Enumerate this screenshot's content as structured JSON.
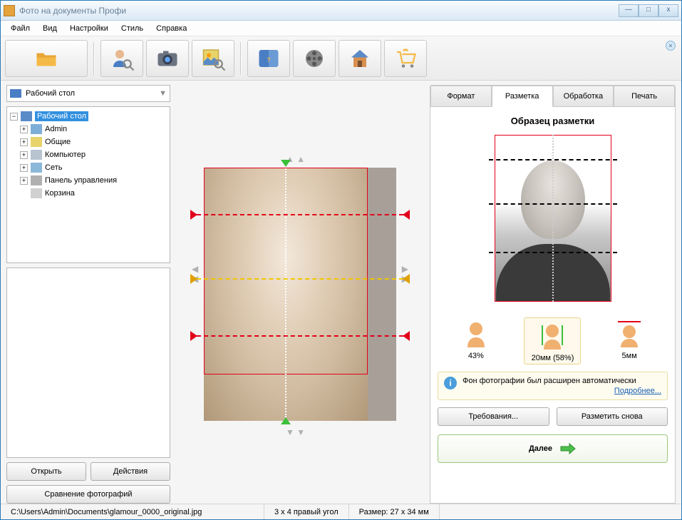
{
  "title": "Фото на документы Профи",
  "menu": {
    "file": "Файл",
    "view": "Вид",
    "settings": "Настройки",
    "style": "Стиль",
    "help": "Справка"
  },
  "winbtns": {
    "min": "—",
    "max": "□",
    "close": "x"
  },
  "dropdown": {
    "label": "Рабочий стол",
    "arrow": "▼"
  },
  "tree": [
    {
      "label": "Рабочий стол",
      "icon": "ic-monitor",
      "expandable": true,
      "expanded": true,
      "selected": true,
      "indent": 0
    },
    {
      "label": "Admin",
      "icon": "ic-folder-blue",
      "expandable": true,
      "expanded": false,
      "indent": 1
    },
    {
      "label": "Общие",
      "icon": "ic-folder",
      "expandable": true,
      "expanded": false,
      "indent": 1
    },
    {
      "label": "Компьютер",
      "icon": "ic-computer",
      "expandable": true,
      "expanded": false,
      "indent": 1
    },
    {
      "label": "Сеть",
      "icon": "ic-network",
      "expandable": true,
      "expanded": false,
      "indent": 1
    },
    {
      "label": "Панель управления",
      "icon": "ic-cpanel",
      "expandable": true,
      "expanded": false,
      "indent": 1
    },
    {
      "label": "Корзина",
      "icon": "ic-trash",
      "expandable": false,
      "indent": 1
    }
  ],
  "leftbtns": {
    "open": "Открыть",
    "actions": "Действия",
    "compare": "Сравнение фотографий"
  },
  "tabs": {
    "format": "Формат",
    "markup": "Разметка",
    "processing": "Обработка",
    "print": "Печать"
  },
  "sample_title": "Образец разметки",
  "measures": {
    "m1": "43%",
    "m2": "20мм (58%)",
    "m3": "5мм"
  },
  "info": {
    "text": "Фон фотографии был расширен автоматически",
    "more": "Подробнее..."
  },
  "actions": {
    "requirements": "Требования...",
    "remark": "Разметить снова",
    "next": "Далее"
  },
  "status": {
    "path": "C:\\Users\\Admin\\Documents\\glamour_0000_original.jpg",
    "crop": "3 x 4 правый угол",
    "size": "Размер: 27 x 34 мм"
  }
}
